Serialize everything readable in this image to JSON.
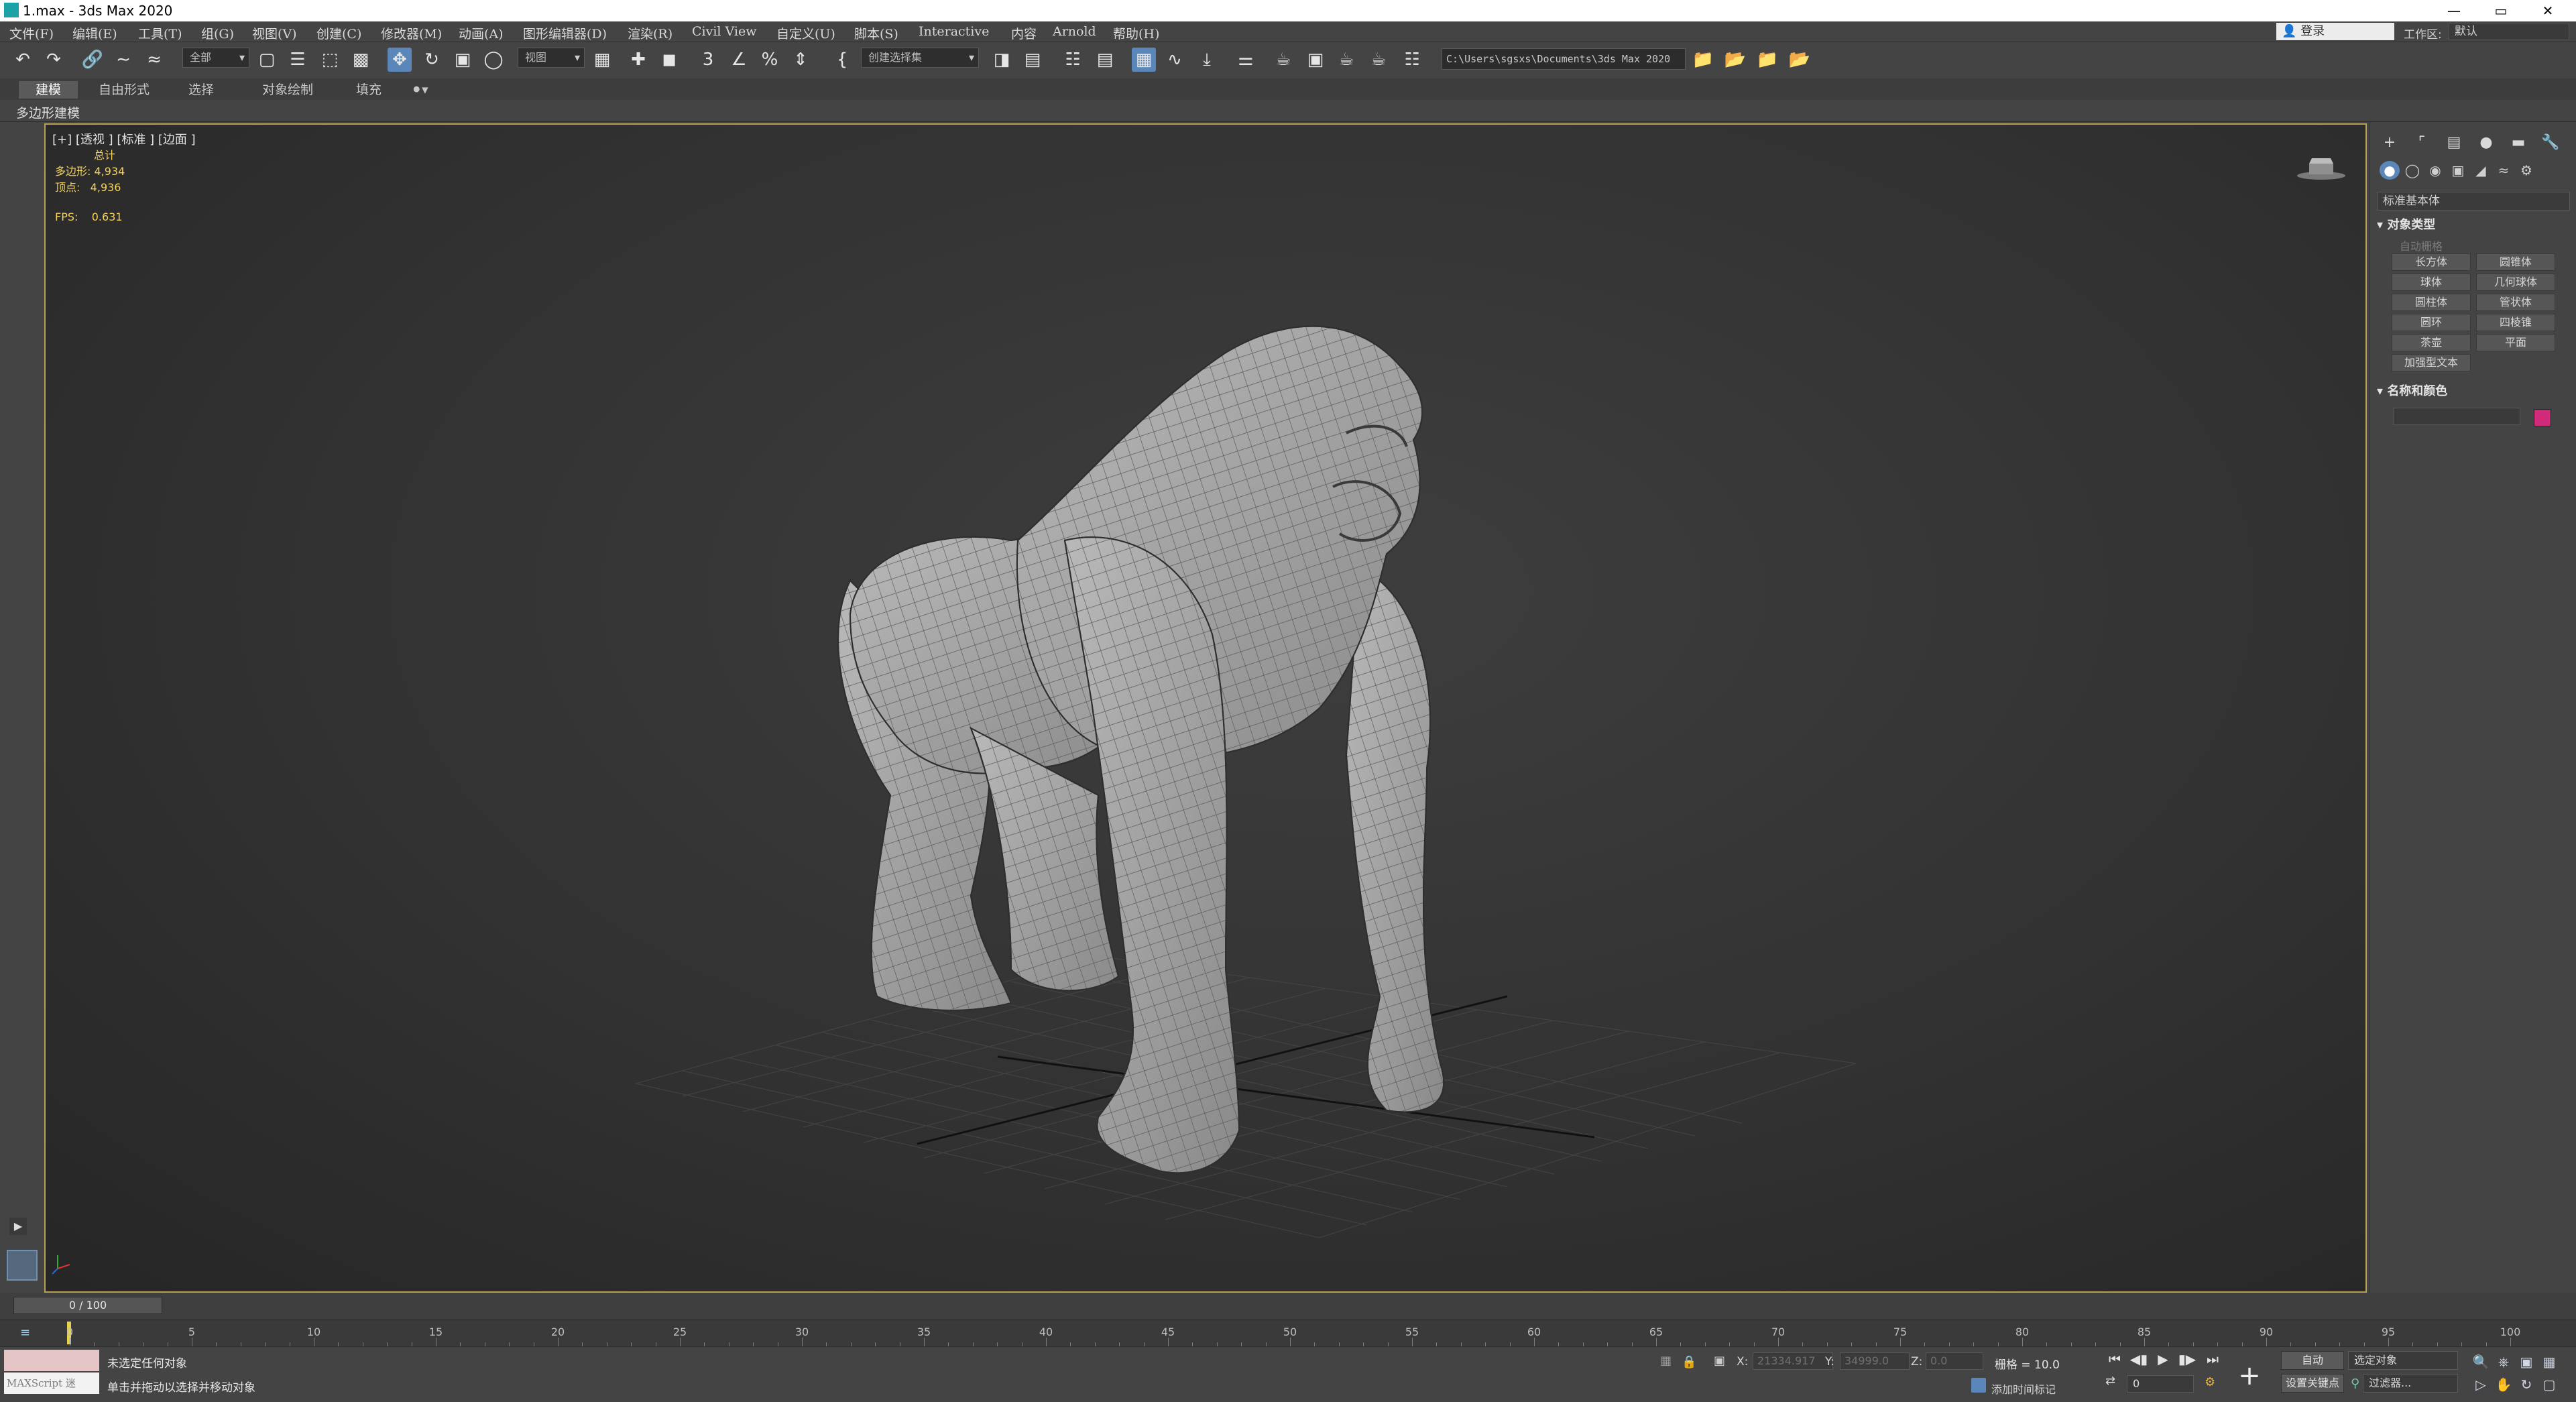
{
  "window": {
    "title": "1.max - 3ds Max 2020",
    "minimize": "—",
    "maximize": "▭",
    "close": "✕"
  },
  "menu": [
    "文件(F)",
    "编辑(E)",
    "工具(T)",
    "组(G)",
    "视图(V)",
    "创建(C)",
    "修改器(M)",
    "动画(A)",
    "图形编辑器(D)",
    "渲染(R)",
    "Civil View",
    "自定义(U)",
    "脚本(S)",
    "Interactive",
    "内容",
    "Arnold",
    "帮助(H)"
  ],
  "account": {
    "signin": "登录",
    "workspace_label": "工作区:",
    "workspace_value": "默认"
  },
  "toolbar": {
    "filter_value": "全部",
    "refcoord_value": "视图",
    "selset_value": "创建选择集",
    "project_path": "C:\\Users\\sgsxs\\Documents\\3ds Max 2020"
  },
  "ribbon": {
    "tabs": [
      "建模",
      "自由形式",
      "选择",
      "对象绘制",
      "填充"
    ],
    "active_tab": "建模",
    "subpanel": "多边形建模"
  },
  "viewport": {
    "label": "[+] [透视 ] [标准 ] [边面 ]",
    "stats_header": "总计",
    "polys_label": "多边形:",
    "polys_value": "4,934",
    "verts_label": "顶点:",
    "verts_value": "4,936",
    "fps_label": "FPS:",
    "fps_value": "0.631"
  },
  "command_panel": {
    "category_dropdown": "标准基本体",
    "object_type_header": "对象类型",
    "autogrid": "自动栅格",
    "object_buttons": [
      "长方体",
      "圆锥体",
      "球体",
      "几何球体",
      "圆柱体",
      "管状体",
      "圆环",
      "四棱锥",
      "茶壶",
      "平面",
      "加强型文本"
    ],
    "name_color_header": "名称和颜色",
    "object_color": "#d02a7a"
  },
  "timeline": {
    "slider_text": "0 / 100",
    "ticks": [
      0,
      5,
      10,
      15,
      20,
      25,
      30,
      35,
      40,
      45,
      50,
      55,
      60,
      65,
      70,
      75,
      80,
      85,
      90,
      95,
      100
    ]
  },
  "status": {
    "maxscript": "MAXScript 迷",
    "line1": "未选定任何对象",
    "line2": "单击并拖动以选择并移动对象",
    "x_label": "X:",
    "x_value": "21334.917",
    "y_label": "Y:",
    "y_value": "34999.0",
    "z_label": "Z:",
    "z_value": "0.0",
    "grid": "栅格 = 10.0",
    "add_time_tag": "添加时间标记",
    "auto_key": "自动",
    "set_key": "设置关键点",
    "selection_filter": "选定对象",
    "key_filters": "过滤器...",
    "frame": "0"
  }
}
